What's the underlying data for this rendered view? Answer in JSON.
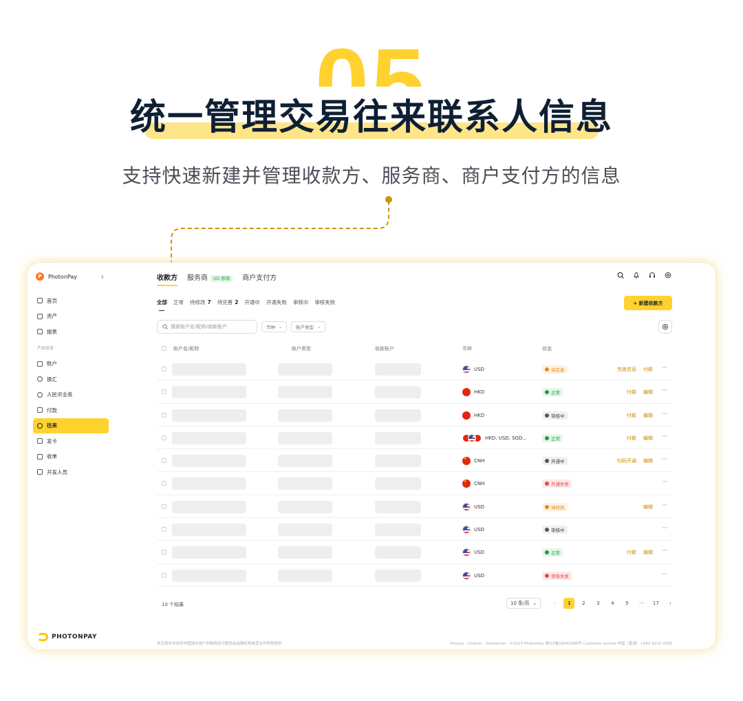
{
  "hero": {
    "number": "05",
    "headline": "统一管理交易往来联系人信息",
    "subline": "支持快速新建并管理收款方、服务商、商户支付方的信息"
  },
  "colors": {
    "accent": "#ffd230",
    "dark": "#0f1f33",
    "link": "#c98a00"
  },
  "app": {
    "brand": "PhotonPay",
    "brand_logo_letter": "P",
    "footer_brand": "PHOTONPAY"
  },
  "sidebar": {
    "items_top": [
      {
        "label": "首页",
        "icon": "home-icon"
      },
      {
        "label": "资产",
        "icon": "wallet-icon"
      },
      {
        "label": "报表",
        "icon": "report-icon"
      }
    ],
    "section_label": "产品总览",
    "items": [
      {
        "label": "账户",
        "icon": "folder-icon"
      },
      {
        "label": "换汇",
        "icon": "exchange-icon"
      },
      {
        "label": "人民币业务",
        "icon": "yuan-icon"
      },
      {
        "label": "付款",
        "icon": "pay-icon"
      },
      {
        "label": "往来",
        "icon": "contacts-icon",
        "active": true
      },
      {
        "label": "发卡",
        "icon": "card-icon"
      },
      {
        "label": "收单",
        "icon": "receipt-icon"
      },
      {
        "label": "开发人员",
        "icon": "link-icon"
      }
    ]
  },
  "tabs": [
    {
      "label": "收款方",
      "active": true
    },
    {
      "label": "服务商",
      "badge": "SD 即将"
    },
    {
      "label": "商户支付方"
    }
  ],
  "top_icons": [
    "search-icon",
    "bell-icon",
    "headset-icon",
    "settings-icon"
  ],
  "filters": [
    {
      "label": "全部",
      "active": true
    },
    {
      "label": "正常"
    },
    {
      "label": "待修改",
      "count": "7"
    },
    {
      "label": "待完善",
      "count": "2"
    },
    {
      "label": "开通中"
    },
    {
      "label": "开通失败"
    },
    {
      "label": "审核中"
    },
    {
      "label": "审核失败"
    }
  ],
  "new_button": "+ 新建收款方",
  "search": {
    "placeholder": "搜索账户名/昵称/收款账户"
  },
  "dropdowns": [
    {
      "label": "币种"
    },
    {
      "label": "账户类型"
    }
  ],
  "table": {
    "headers": [
      "账户名/昵称",
      "账户类型",
      "收款账户",
      "币种",
      "状态"
    ],
    "rows": [
      {
        "flags": [
          "us"
        ],
        "currency": "USD",
        "status": "待完善",
        "status_type": "pending",
        "actions": [
          "完善信息",
          "付款"
        ]
      },
      {
        "flags": [
          "hk"
        ],
        "currency": "HKD",
        "status": "正常",
        "status_type": "normal",
        "actions": [
          "付款",
          "编辑"
        ]
      },
      {
        "flags": [
          "hk"
        ],
        "currency": "HKD",
        "status": "审核中",
        "status_type": "review",
        "actions": [
          "付款",
          "编辑"
        ]
      },
      {
        "flags": [
          "hk",
          "us",
          "sg"
        ],
        "currency": "HKD, USD, SGD...",
        "status": "正常",
        "status_type": "normal",
        "actions": [
          "付款",
          "编辑"
        ]
      },
      {
        "flags": [
          "cn"
        ],
        "currency": "CNH",
        "status": "开通中",
        "status_type": "review",
        "actions": [
          "扫码开通",
          "编辑"
        ]
      },
      {
        "flags": [
          "cn"
        ],
        "currency": "CNH",
        "status": "开通失败",
        "status_type": "fail",
        "actions": []
      },
      {
        "flags": [
          "us"
        ],
        "currency": "USD",
        "status": "待修改",
        "status_type": "pending",
        "actions": [
          "编辑"
        ]
      },
      {
        "flags": [
          "us"
        ],
        "currency": "USD",
        "status": "审核中",
        "status_type": "review",
        "actions": []
      },
      {
        "flags": [
          "us"
        ],
        "currency": "USD",
        "status": "正常",
        "status_type": "normal",
        "actions": [
          "付款",
          "编辑"
        ]
      },
      {
        "flags": [
          "us"
        ],
        "currency": "USD",
        "status": "审核失败",
        "status_type": "fail",
        "actions": []
      }
    ],
    "more_glyph": "···"
  },
  "pagination": {
    "total_text": "10 个结果",
    "page_size": "10 条/页",
    "pages": [
      "1",
      "2",
      "3",
      "4",
      "5",
      "···",
      "17"
    ],
    "current": "1",
    "prev": "‹",
    "next": "›"
  },
  "footer": {
    "left": "本页面所涉及的中国境内用户的跨境支付服务由金融机构或其合作机构提供",
    "right": "Privacy · Cookies · Disclaimer · ©2025 PhotonPay 粤ICP备19042089号    Customer service 中国（香港）+852 6210 4358"
  }
}
